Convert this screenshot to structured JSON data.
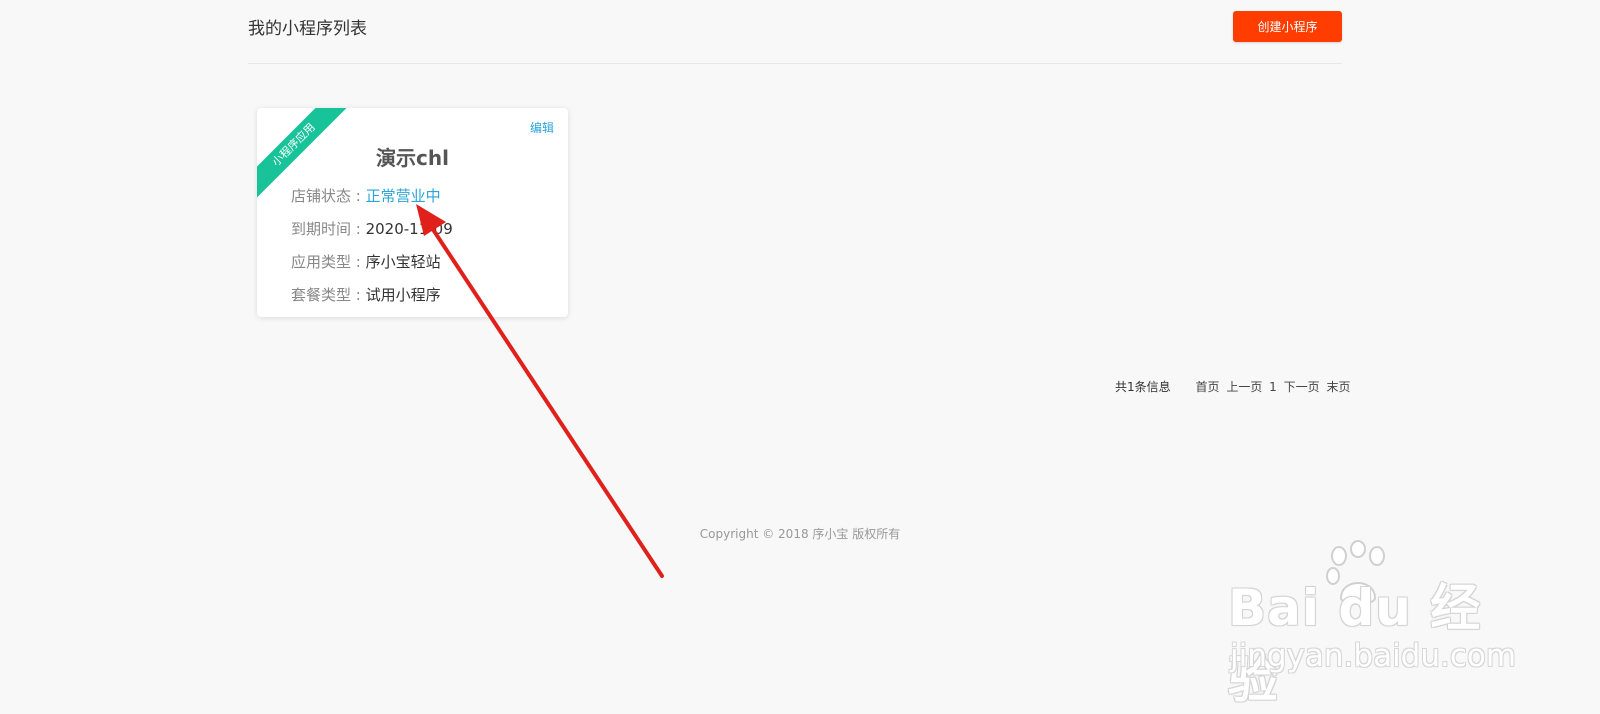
{
  "header": {
    "title": "我的小程序列表",
    "create_button": "创建小程序"
  },
  "card": {
    "ribbon": "小程序应用",
    "edit": "编辑",
    "name": "演示chl",
    "rows": [
      {
        "label": "店铺状态 : ",
        "value": "正常营业中"
      },
      {
        "label": "到期时间 : ",
        "value": "2020-11-09"
      },
      {
        "label": "应用类型 : ",
        "value": "序小宝轻站"
      },
      {
        "label": "套餐类型 : ",
        "value": "试用小程序"
      }
    ]
  },
  "pagination": {
    "total": "共1条信息",
    "first": "首页",
    "prev": "上一页",
    "current": "1",
    "next": "下一页",
    "last": "末页"
  },
  "footer": {
    "copyright": "Copyright © 2018 序小宝 版权所有"
  },
  "watermark": {
    "brand": "Bai du 经验",
    "url": "jingyan.baidu.com"
  },
  "colors": {
    "accent_button": "#ff3d00",
    "ribbon": "#19c39a",
    "link": "#2aa5d9",
    "annotation_arrow": "#e0201b"
  }
}
